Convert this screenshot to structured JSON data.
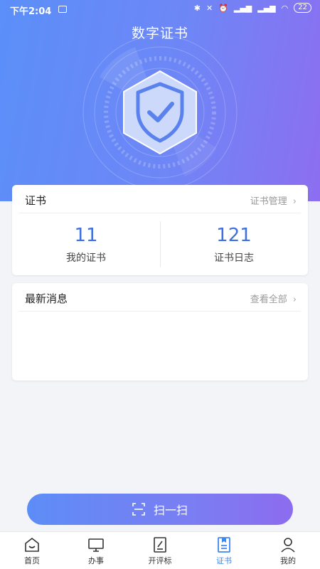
{
  "status_bar": {
    "time": "下午2:04",
    "battery": "22"
  },
  "page_title": "数字证书",
  "certificates_card": {
    "title": "证书",
    "link_label": "证书管理",
    "stats": [
      {
        "value": "11",
        "label": "我的证书"
      },
      {
        "value": "121",
        "label": "证书日志"
      }
    ]
  },
  "news_card": {
    "title": "最新消息",
    "link_label": "查看全部"
  },
  "scan_button": {
    "label": "扫一扫"
  },
  "tabbar": {
    "items": [
      {
        "label": "首页",
        "icon": "home-icon"
      },
      {
        "label": "办事",
        "icon": "monitor-icon"
      },
      {
        "label": "开评标",
        "icon": "edit-document-icon"
      },
      {
        "label": "证书",
        "icon": "certificate-icon",
        "active": true
      },
      {
        "label": "我的",
        "icon": "user-icon"
      }
    ],
    "active_color": "#3f86f2"
  },
  "colors": {
    "hero_start": "#5b8ff9",
    "hero_end": "#8d6ef0",
    "accent": "#3f6fe0"
  }
}
